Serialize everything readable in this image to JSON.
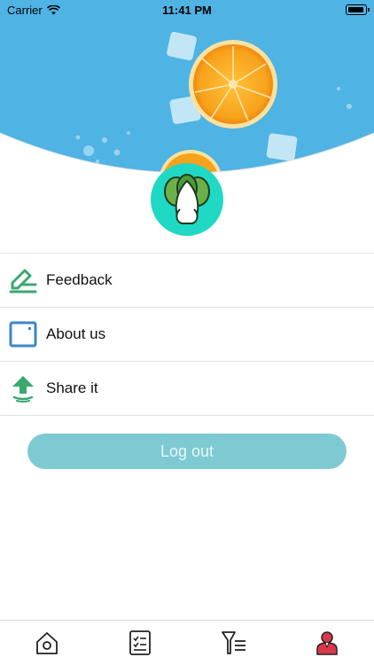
{
  "status_bar": {
    "carrier": "Carrier",
    "time": "11:41 PM"
  },
  "menu": {
    "items": [
      {
        "label": "Feedback",
        "icon": "feedback-pen-icon"
      },
      {
        "label": "About us",
        "icon": "about-window-icon"
      },
      {
        "label": "Share it",
        "icon": "share-arrow-icon"
      }
    ]
  },
  "logout": {
    "label": "Log out"
  },
  "tabbar": {
    "tabs": [
      {
        "icon": "home-icon"
      },
      {
        "icon": "checklist-icon"
      },
      {
        "icon": "filter-list-icon"
      },
      {
        "icon": "profile-icon",
        "active": true
      }
    ]
  },
  "colors": {
    "banner_blue": "#4fb3e4",
    "avatar_bg": "#1fd9c4",
    "logout_bg": "#7ecad2",
    "icon_green": "#3aa86f",
    "icon_blue": "#3a87c9",
    "profile_red": "#d9374a"
  }
}
